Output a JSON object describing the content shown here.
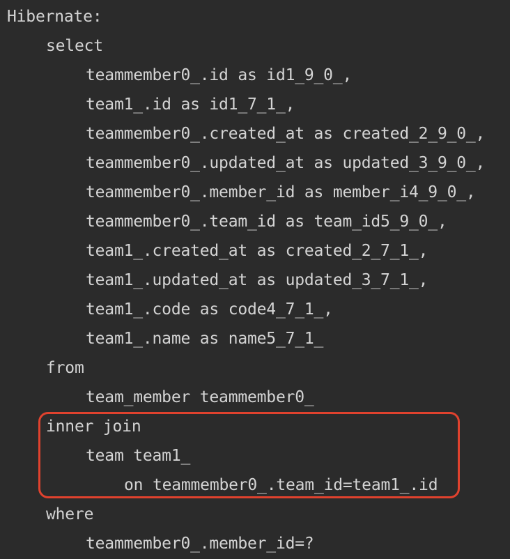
{
  "log": {
    "header": "Hibernate:",
    "lines": [
      "select",
      "teammember0_.id as id1_9_0_,",
      "team1_.id as id1_7_1_,",
      "teammember0_.created_at as created_2_9_0_,",
      "teammember0_.updated_at as updated_3_9_0_,",
      "teammember0_.member_id as member_i4_9_0_,",
      "teammember0_.team_id as team_id5_9_0_,",
      "team1_.created_at as created_2_7_1_,",
      "team1_.updated_at as updated_3_7_1_,",
      "team1_.code as code4_7_1_,",
      "team1_.name as name5_7_1_",
      "from",
      "team_member teammember0_",
      "inner join",
      "team team1_",
      "on teammember0_.team_id=team1_.id",
      "where",
      "teammember0_.member_id=?"
    ]
  },
  "highlight": {
    "color": "#e0422e"
  },
  "colors": {
    "background": "#2b2b2b",
    "text": "#d4d4d4"
  }
}
